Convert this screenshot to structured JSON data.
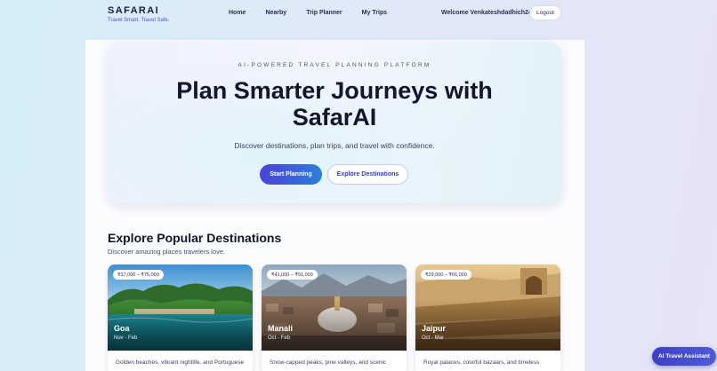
{
  "brand": {
    "name": "SAFARAI",
    "tagline": "Travel Smart. Travel Safe."
  },
  "nav": {
    "items": [
      "Home",
      "Nearby",
      "Trip Planner",
      "My Trips"
    ]
  },
  "user": {
    "welcome": "Welcome Venkateshdadhich24",
    "logout_label": "Logout"
  },
  "hero": {
    "eyebrow": "AI-POWERED TRAVEL PLANNING PLATFORM",
    "title": "Plan Smarter Journeys with SafarAI",
    "subtitle": "Discover destinations, plan trips, and travel with confidence.",
    "primary_cta": "Start Planning",
    "secondary_cta": "Explore Destinations"
  },
  "destinations": {
    "title": "Explore Popular Destinations",
    "subtitle": "Discover amazing places travelers love.",
    "cards": [
      {
        "name": "Goa",
        "season": "Nov - Feb",
        "price": "₹37,000 – ₹75,000",
        "description": "Golden beaches, vibrant nightlife, and Portuguese"
      },
      {
        "name": "Manali",
        "season": "Oct - Feb",
        "price": "₹41,000 – ₹91,000",
        "description": "Snow-capped peaks, pine valleys, and scenic"
      },
      {
        "name": "Jaipur",
        "season": "Oct - Mar",
        "price": "₹29,000 – ₹66,000",
        "description": "Royal palaces, colorful bazaars, and timeless"
      }
    ]
  },
  "assistant": {
    "label": "AI Travel Assistant"
  },
  "colors": {
    "accent": "#4b42d6",
    "accent2": "#2b7fd8"
  }
}
